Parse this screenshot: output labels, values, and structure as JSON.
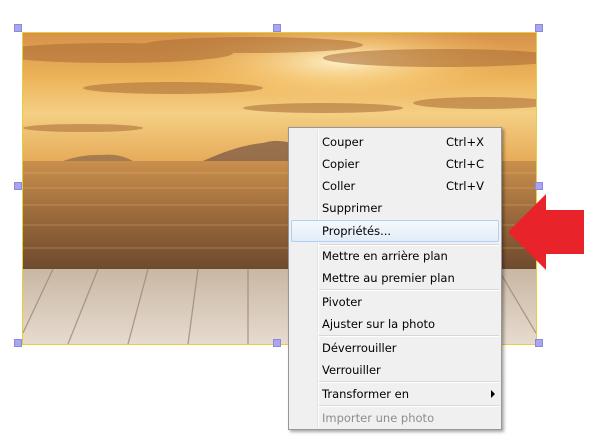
{
  "photo": {
    "subject": "sunset-sea-pier-photo",
    "colors": {
      "sky": "#e7a94a",
      "sea": "#9a6a3a",
      "deck": "#d8cbbd",
      "frame": "#e8cf3a",
      "handle": "#a9a6f0"
    }
  },
  "arrow": {
    "color": "#e8232a",
    "icon": "red-arrow-left-icon"
  },
  "context_menu": {
    "items": [
      {
        "label": "Couper",
        "shortcut": "Ctrl+X"
      },
      {
        "label": "Copier",
        "shortcut": "Ctrl+C"
      },
      {
        "label": "Coller",
        "shortcut": "Ctrl+V"
      },
      {
        "label": "Supprimer",
        "shortcut": ""
      },
      {
        "label": "Propriétés...",
        "shortcut": "",
        "state": "highlighted"
      },
      {
        "label": "Mettre en arrière plan",
        "shortcut": ""
      },
      {
        "label": "Mettre au premier plan",
        "shortcut": ""
      },
      {
        "label": "Pivoter",
        "shortcut": ""
      },
      {
        "label": "Ajuster sur la photo",
        "shortcut": ""
      },
      {
        "label": "Déverrouiller",
        "shortcut": ""
      },
      {
        "label": "Verrouiller",
        "shortcut": ""
      },
      {
        "label": "Transformer en",
        "shortcut": "",
        "submenu": true
      },
      {
        "label": "Importer une photo",
        "shortcut": "",
        "state": "disabled"
      }
    ]
  }
}
